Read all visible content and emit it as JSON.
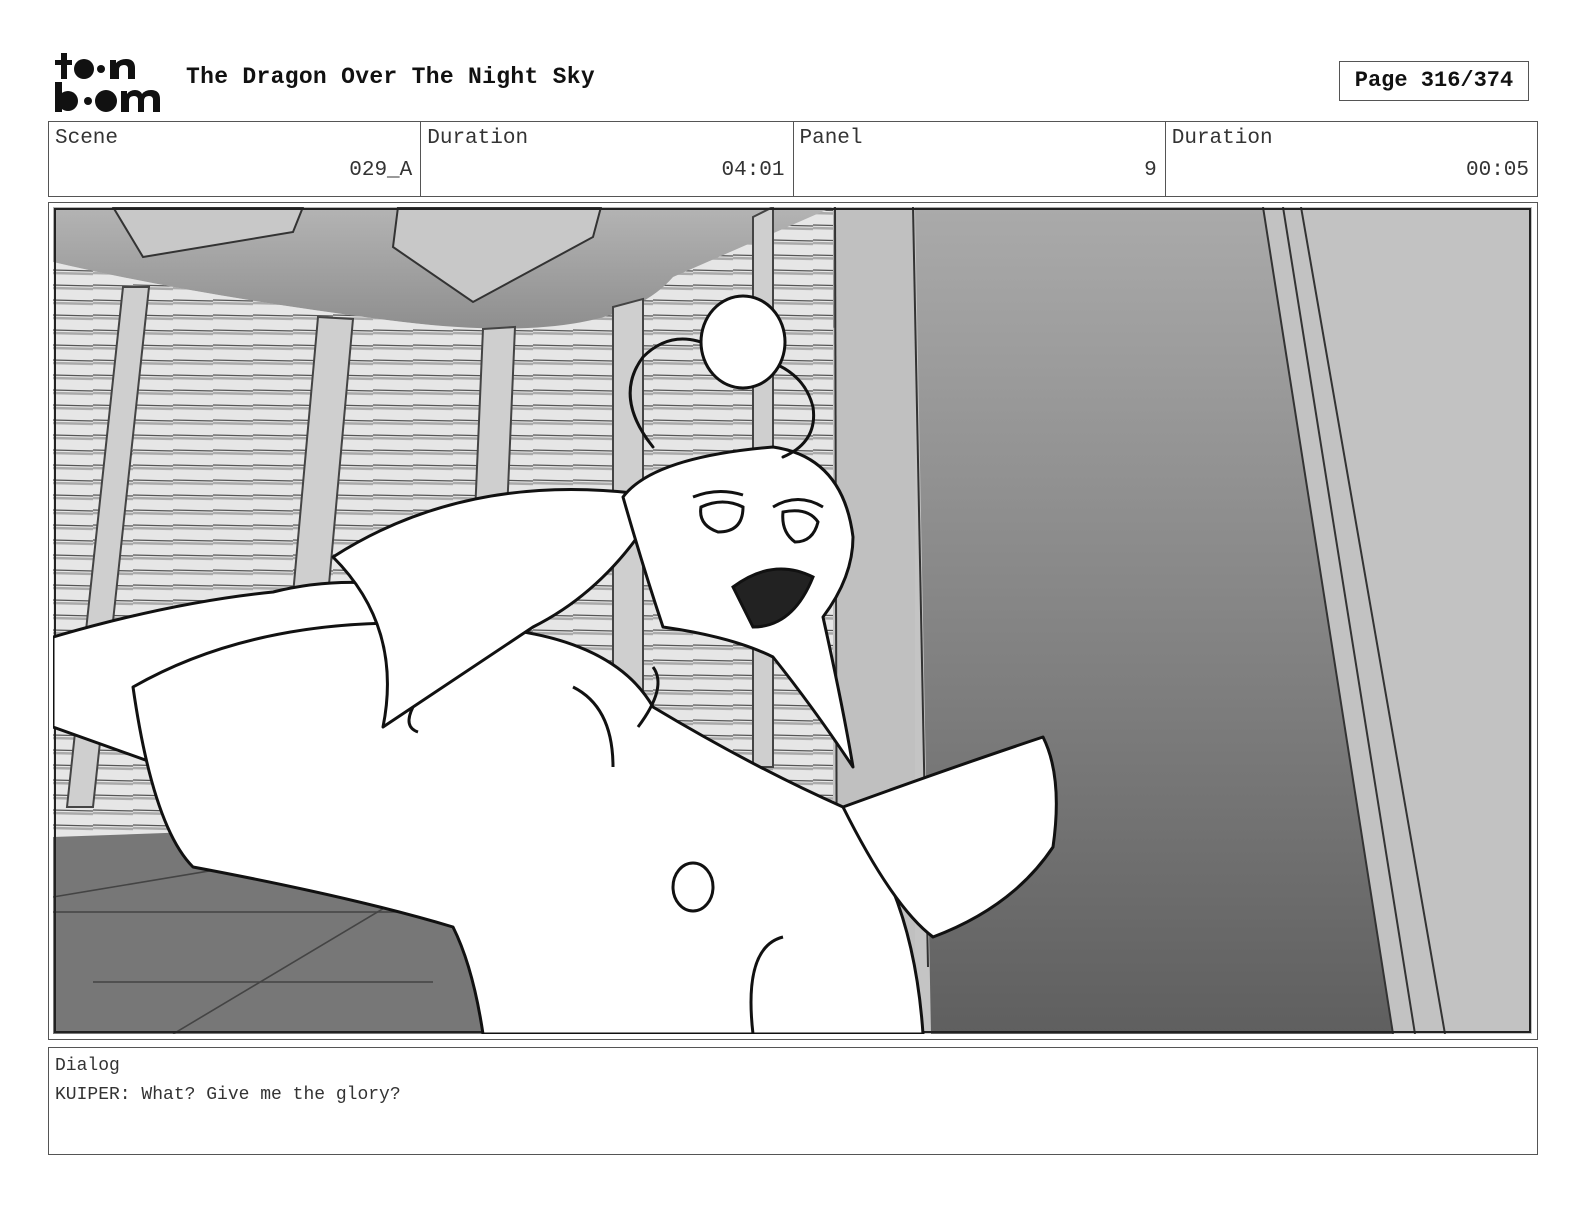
{
  "header": {
    "logo_name": "toon-boom-logo",
    "title": "The Dragon Over The Night Sky",
    "page_indicator": "Page 316/374"
  },
  "info": {
    "scene_label": "Scene",
    "scene_value": "029_A",
    "scene_duration_label": "Duration",
    "scene_duration_value": "04:01",
    "panel_label": "Panel",
    "panel_value": "9",
    "panel_duration_label": "Duration",
    "panel_duration_value": "00:05"
  },
  "dialog": {
    "label": "Dialog",
    "text": "KUIPER: What? Give me the glory?"
  },
  "colors": {
    "border": "#555555",
    "ink": "#111111",
    "panel_light": "#d0d0d0",
    "panel_dark": "#666666"
  }
}
